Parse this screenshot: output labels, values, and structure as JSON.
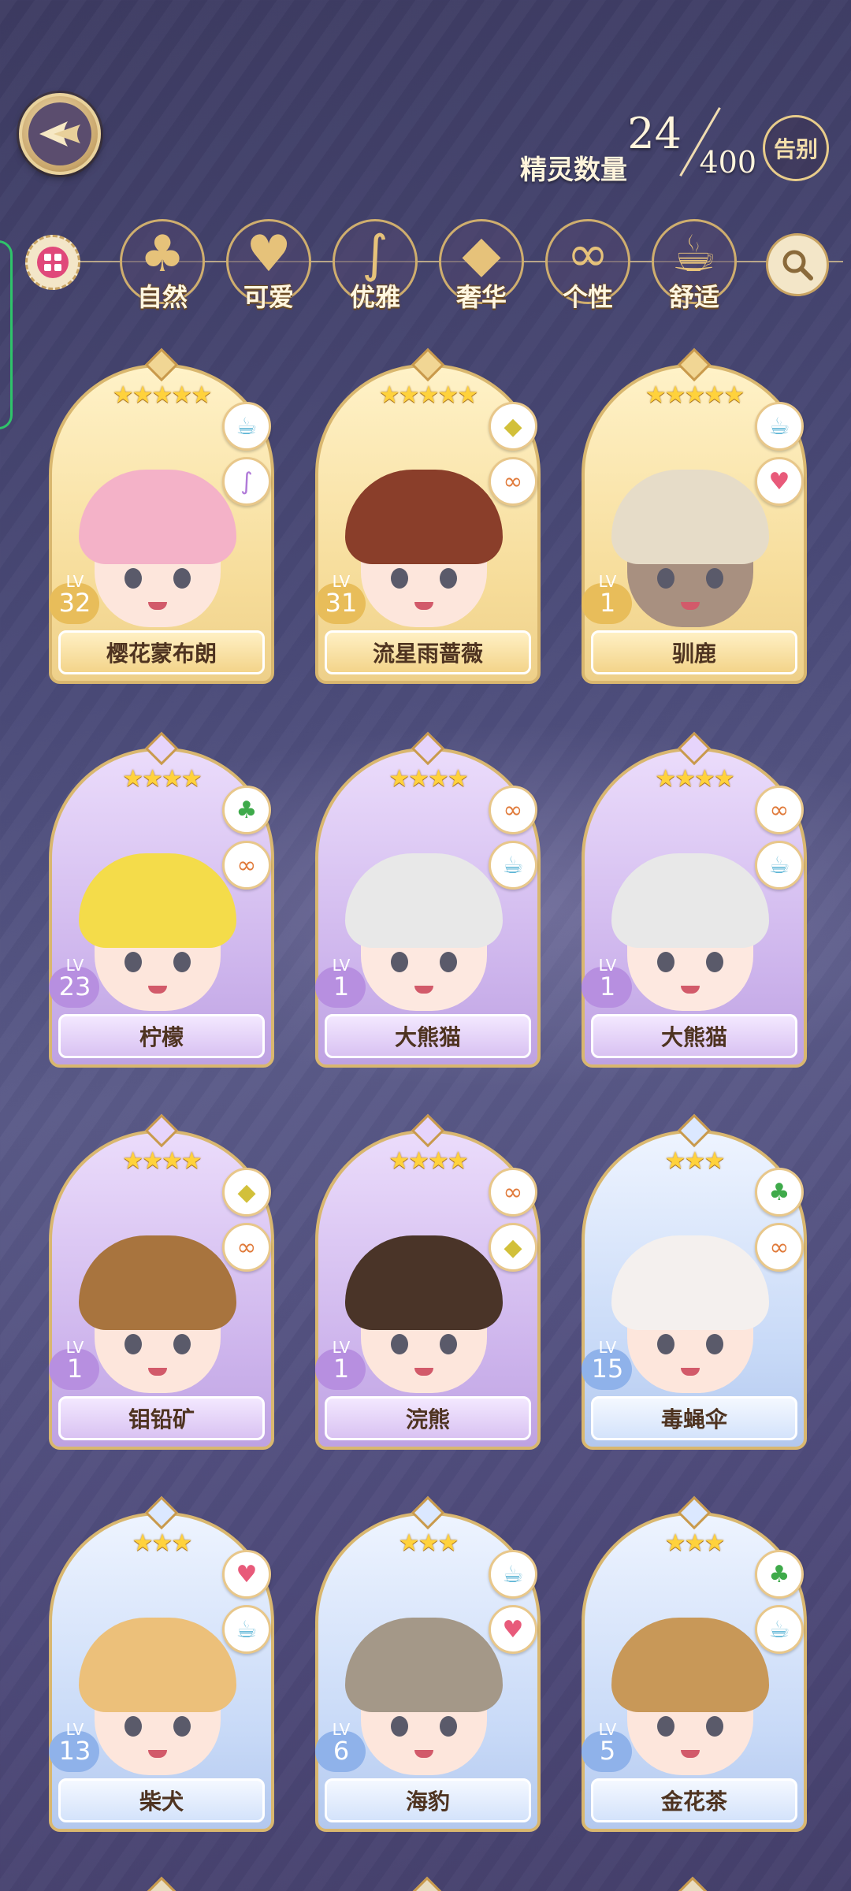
{
  "header": {
    "count_label": "精灵数量",
    "count_current": "24",
    "count_max": "400",
    "farewell_label": "告别"
  },
  "filters": [
    {
      "label": "自然",
      "icon": "clover-icon",
      "glyph": "♣"
    },
    {
      "label": "可爱",
      "icon": "heart-icon",
      "glyph": "♥"
    },
    {
      "label": "优雅",
      "icon": "swan-icon",
      "glyph": "∫"
    },
    {
      "label": "奢华",
      "icon": "diamond-icon",
      "glyph": "◆"
    },
    {
      "label": "个性",
      "icon": "glasses-icon",
      "glyph": "∞"
    },
    {
      "label": "舒适",
      "icon": "teacup-icon",
      "glyph": "☕"
    }
  ],
  "sprites": [
    {
      "name": "樱花蒙布朗",
      "level": "32",
      "lv_label": "LV",
      "stars": "★★★★★",
      "rarity": "gold",
      "traits": [
        "teacup-icon",
        "swan-icon"
      ],
      "hair": "#f4b2c8",
      "skin": "#fde6dc"
    },
    {
      "name": "流星雨蔷薇",
      "level": "31",
      "lv_label": "LV",
      "stars": "★★★★★",
      "rarity": "gold",
      "traits": [
        "diamond-icon",
        "glasses-icon"
      ],
      "hair": "#8a3e2a",
      "skin": "#fde6dc"
    },
    {
      "name": "驯鹿",
      "level": "1",
      "lv_label": "LV",
      "stars": "★★★★★",
      "rarity": "gold",
      "traits": [
        "teacup-icon",
        "heart-icon"
      ],
      "hair": "#e6dcc8",
      "skin": "#a89080"
    },
    {
      "name": "柠檬",
      "level": "23",
      "lv_label": "LV",
      "stars": "★★★★",
      "rarity": "purple",
      "traits": [
        "clover-icon",
        "glasses-icon"
      ],
      "hair": "#f4dc4a",
      "skin": "#fde6dc"
    },
    {
      "name": "大熊猫",
      "level": "1",
      "lv_label": "LV",
      "stars": "★★★★",
      "rarity": "purple",
      "traits": [
        "glasses-icon",
        "teacup-icon"
      ],
      "hair": "#e8e8e8",
      "skin": "#fde8e0"
    },
    {
      "name": "大熊猫",
      "level": "1",
      "lv_label": "LV",
      "stars": "★★★★",
      "rarity": "purple",
      "traits": [
        "glasses-icon",
        "teacup-icon"
      ],
      "hair": "#e8e8e8",
      "skin": "#fde8e0"
    },
    {
      "name": "钼铅矿",
      "level": "1",
      "lv_label": "LV",
      "stars": "★★★★",
      "rarity": "purple",
      "traits": [
        "diamond-icon",
        "glasses-icon"
      ],
      "hair": "#a8743e",
      "skin": "#fde6dc"
    },
    {
      "name": "浣熊",
      "level": "1",
      "lv_label": "LV",
      "stars": "★★★★",
      "rarity": "purple",
      "traits": [
        "glasses-icon",
        "diamond-icon"
      ],
      "hair": "#4a3428",
      "skin": "#fde6dc"
    },
    {
      "name": "毒蝇伞",
      "level": "15",
      "lv_label": "LV",
      "stars": "★★★",
      "rarity": "blue",
      "traits": [
        "clover-icon",
        "glasses-icon"
      ],
      "hair": "#f4f0ee",
      "skin": "#fde6dc"
    },
    {
      "name": "柴犬",
      "level": "13",
      "lv_label": "LV",
      "stars": "★★★",
      "rarity": "blue",
      "traits": [
        "heart-icon",
        "teacup-icon"
      ],
      "hair": "#ecc07a",
      "skin": "#fde6dc"
    },
    {
      "name": "海豹",
      "level": "6",
      "lv_label": "LV",
      "stars": "★★★",
      "rarity": "blue",
      "traits": [
        "teacup-icon",
        "heart-icon"
      ],
      "hair": "#a49888",
      "skin": "#fde6dc"
    },
    {
      "name": "金花茶",
      "level": "5",
      "lv_label": "LV",
      "stars": "★★★",
      "rarity": "blue",
      "traits": [
        "clover-icon",
        "teacup-icon"
      ],
      "hair": "#c89858",
      "skin": "#fde6dc"
    }
  ],
  "trait_glyphs": {
    "teacup-icon": "☕",
    "swan-icon": "∫",
    "diamond-icon": "◆",
    "glasses-icon": "∞",
    "heart-icon": "♥",
    "clover-icon": "♣"
  },
  "trait_colors": {
    "teacup-icon": "#5fb6d6",
    "swan-icon": "#b07ad8",
    "diamond-icon": "#d2c03a",
    "glasses-icon": "#e07a3a",
    "heart-icon": "#e85a7a",
    "clover-icon": "#3eaa4a"
  }
}
